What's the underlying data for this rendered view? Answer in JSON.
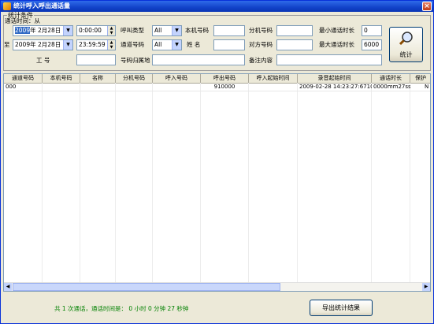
{
  "window": {
    "title": "统计呼入呼出通话量",
    "close_label": "×"
  },
  "conditions": {
    "legend": "统计条件",
    "time_label": "通话时间：从",
    "to_label": "至",
    "from_year": "2009",
    "from_year_suffix": "年",
    "from_date": "2月28日",
    "from_time": "0:00:00",
    "to_date": "2009年  2月28日",
    "to_time": "23:59:59",
    "call_type_label": "呼叫类型",
    "call_type_value": "All",
    "channel_label": "通道号码",
    "channel_value": "All",
    "local_number_label": "本机号码",
    "local_number_value": "",
    "name_label": "姓 名",
    "name_value": "",
    "extension_label": "分机号码",
    "extension_value": "",
    "peer_number_label": "对方号码",
    "peer_number_value": "",
    "min_duration_label": "最小通话时长",
    "min_duration_value": "0",
    "max_duration_label": "最大通话时长",
    "max_duration_value": "6000",
    "employee_id_label": "工   号",
    "employee_id_value": "",
    "number_region_label": "号码归属地",
    "number_region_value": "",
    "note_label": "备注内容",
    "note_value": "",
    "stats_button": "统计"
  },
  "table": {
    "columns": [
      "通道号码",
      "本机号码",
      "名称",
      "分机号码",
      "呼入号码",
      "呼出号码",
      "呼入起始时间",
      "录音起始时间",
      "通话时长",
      "保护"
    ],
    "rows": [
      [
        "000",
        "",
        "",
        "",
        "",
        "910000",
        "",
        "2009-02-28 14:23:27:671000",
        "0000mm27ss",
        "N"
      ]
    ]
  },
  "footer": {
    "summary": "共 1 次通话，通话时间是： 0 小时 0 分钟 27 秒钟",
    "export_button": "导出统计结果"
  },
  "colors": {
    "title_bar": "#1243c9",
    "summary_text": "#008000",
    "face": "#ece9d8"
  }
}
